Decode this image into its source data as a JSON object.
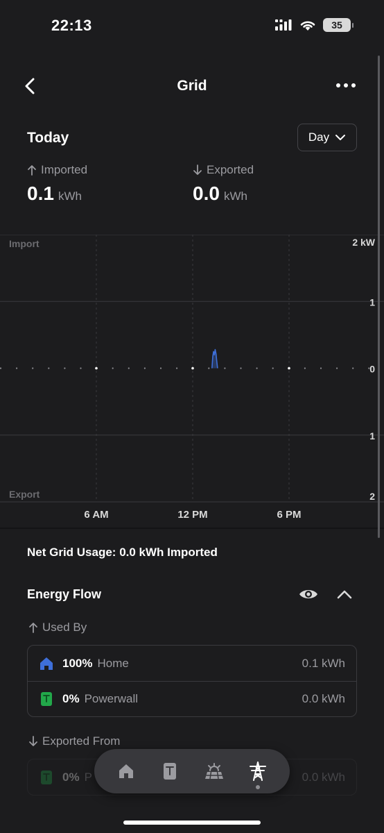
{
  "status_bar": {
    "time": "22:13",
    "battery": "35"
  },
  "header": {
    "title": "Grid",
    "back_icon": "chevron-left-icon",
    "more_icon": "ellipsis-icon"
  },
  "summary": {
    "period": "Today",
    "range_button": "Day",
    "imported": {
      "label": "Imported",
      "value": "0.1",
      "unit": "kWh"
    },
    "exported": {
      "label": "Exported",
      "value": "0.0",
      "unit": "kWh"
    }
  },
  "chart_data": {
    "type": "area",
    "top_label": "Import",
    "bottom_label": "Export",
    "y_unit": "kW",
    "y_tick_labels": [
      "2 kW",
      "1",
      "0",
      "1",
      "2"
    ],
    "x_tick_labels": [
      "6 AM",
      "12 PM",
      "6 PM"
    ],
    "ylim": [
      -2,
      2
    ],
    "xlim_hours": [
      0,
      24
    ],
    "grid": true,
    "series": [
      {
        "color": "#3e6fd9",
        "x_hours": [
          13.2,
          13.25,
          13.3,
          13.35,
          13.4,
          13.45,
          13.5,
          13.55
        ],
        "values": [
          0,
          0.18,
          0.25,
          0.2,
          0.28,
          0.22,
          0.1,
          0
        ]
      }
    ]
  },
  "net_usage": "Net Grid Usage: 0.0 kWh Imported",
  "energy_flow": {
    "title": "Energy Flow",
    "used_by_label": "Used By",
    "used_by": [
      {
        "icon": "home-icon",
        "icon_color": "#3e6fd9",
        "percent": "100%",
        "name": "Home",
        "value": "0.1 kWh"
      },
      {
        "icon": "powerwall-icon",
        "icon_color": "#22a84a",
        "percent": "0%",
        "name": "Powerwall",
        "value": "0.0 kWh"
      }
    ],
    "exported_from_label": "Exported From",
    "exported_from": [
      {
        "icon": "powerwall-icon",
        "icon_color": "#22a84a",
        "percent": "0%",
        "name": "P",
        "value": "0.0 kWh"
      }
    ]
  },
  "bottom_nav": [
    "home-icon",
    "powerwall-icon",
    "solar-icon",
    "grid-tower-icon"
  ]
}
